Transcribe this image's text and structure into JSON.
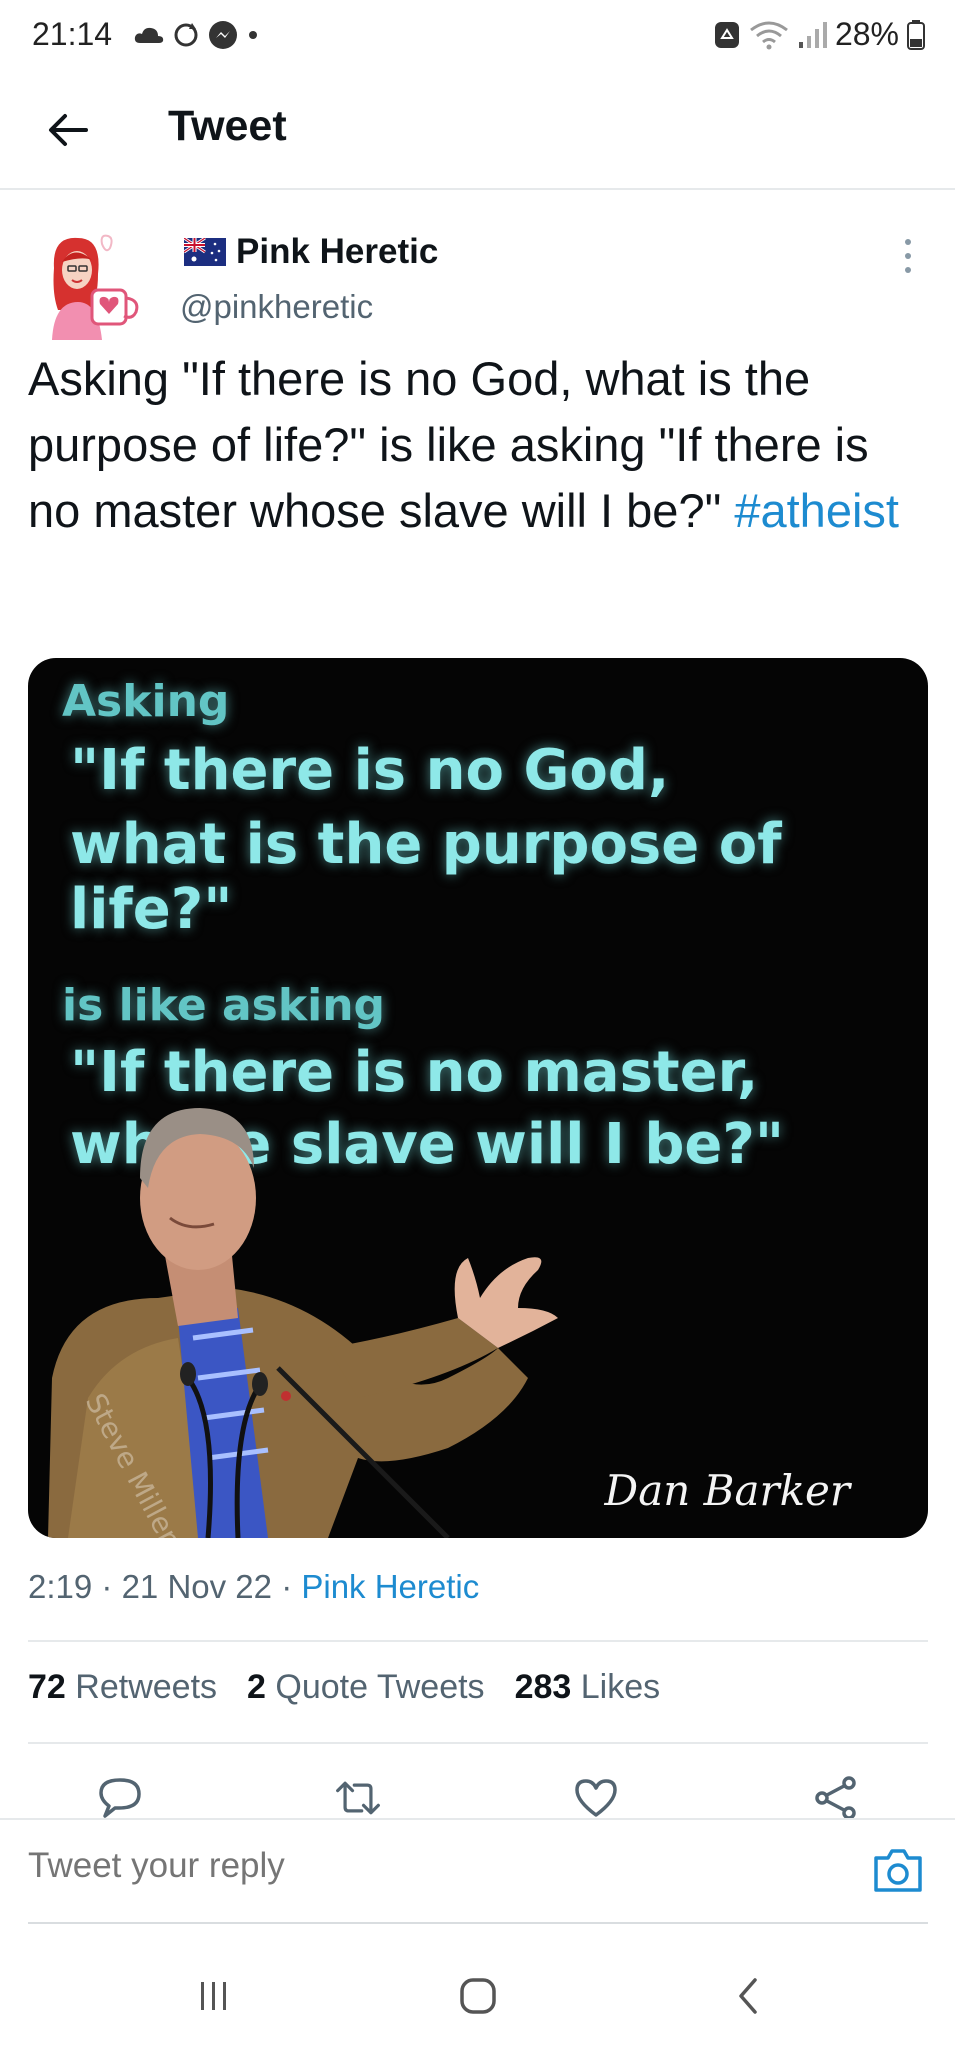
{
  "status_bar": {
    "time": "21:14",
    "battery": "28%"
  },
  "header": {
    "title": "Tweet"
  },
  "tweet": {
    "author_name": "Pink Heretic",
    "author_handle": "@pinkheretic",
    "text": "Asking \"If there is no God, what is the purpose of life?\" is like asking \"If there is no master whose slave will I be?\" ",
    "hashtag": "#atheist",
    "image": {
      "line1": "Asking",
      "line2": "\"If there is no God,",
      "line3": "what is the purpose of life?\"",
      "line4": "is like asking",
      "line5": "\"If there is no master,",
      "line6": "whose slave will I be?\"",
      "photo_watermark": "Steve Miller",
      "signature": "Dan Barker"
    },
    "time": "2:19",
    "date": "21 Nov 22",
    "source": "Pink Heretic",
    "separator": "·",
    "stats": {
      "retweets_count": "72",
      "retweets_label": "Retweets",
      "quotes_count": "2",
      "quotes_label": "Quote Tweets",
      "likes_count": "283",
      "likes_label": "Likes"
    }
  },
  "reply": {
    "placeholder": "Tweet your reply"
  },
  "colors": {
    "link": "#1d8bd0",
    "secondary_text": "#536471",
    "image_text": "#8ee8e8"
  }
}
